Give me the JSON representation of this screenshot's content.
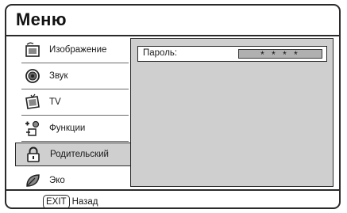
{
  "menu": {
    "title": "Меню",
    "items": [
      {
        "label": "Изображение",
        "icon": "picture-icon"
      },
      {
        "label": "Звук",
        "icon": "speaker-icon"
      },
      {
        "label": "TV",
        "icon": "tv-icon"
      },
      {
        "label": "Функции",
        "icon": "features-icon"
      },
      {
        "label": "Родительский",
        "icon": "padlock-icon",
        "active": true
      },
      {
        "label": "Эко",
        "icon": "eco-leaf-icon"
      }
    ]
  },
  "content": {
    "password_label": "Пароль:",
    "password_value": "* * * *"
  },
  "footer": {
    "exit_key": "EXIT",
    "back_label": "Назад"
  },
  "colors": {
    "panel_gray": "#cfcfcf",
    "border": "#2a2a2a",
    "field_gray": "#b0b0b0"
  }
}
